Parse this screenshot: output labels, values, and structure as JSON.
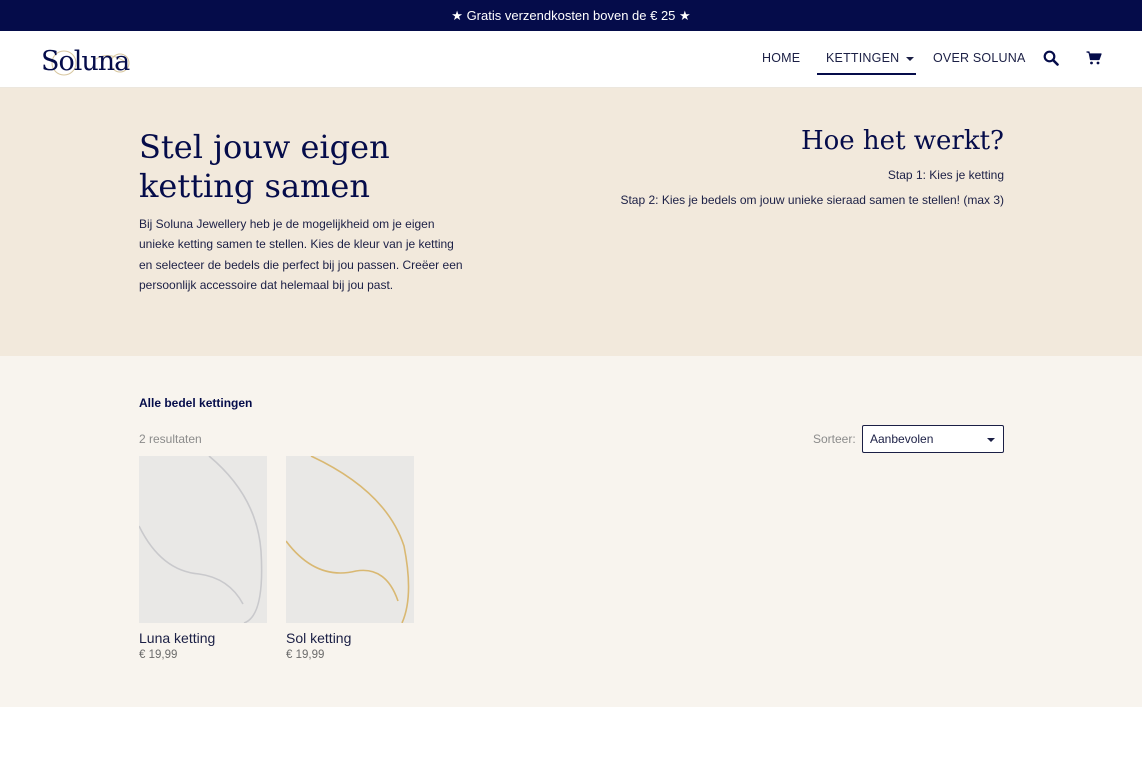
{
  "promo": {
    "text": "★ Gratis verzendkosten boven de € 25 ★"
  },
  "header": {
    "logo_text": "Soluna",
    "nav": {
      "home": "HOME",
      "kettingen": "KETTINGEN",
      "over": "OVER SOLUNA"
    },
    "icons": {
      "search": "search-icon",
      "cart": "cart-icon"
    }
  },
  "hero": {
    "title": "Stel jouw eigen ketting samen",
    "text": "Bij Soluna Jewellery heb je de mogelijkheid om je eigen unieke ketting samen te stellen. Kies de kleur van je ketting en selecteer de bedels die perfect bij jou passen. Creëer een persoonlijk accessoire dat helemaal bij jou past.",
    "how_title": "Hoe het werkt?",
    "step1": "Stap 1: Kies je ketting",
    "step2": "Stap 2: Kies je bedels om jouw unieke sieraad samen te stellen! (max 3)"
  },
  "catalog": {
    "title": "Alle bedel kettingen",
    "result_count": "2 resultaten",
    "sort_label": "Sorteer:",
    "sort_value": "Aanbevolen",
    "products": [
      {
        "name": "Luna ketting",
        "price": "€ 19,99",
        "chain_color": "#c9c9cc"
      },
      {
        "name": "Sol ketting",
        "price": "€ 19,99",
        "chain_color": "#d9b872"
      }
    ]
  },
  "colors": {
    "navy": "#050c4a",
    "hero_bg": "#f2e9dc",
    "catalog_bg": "#f8f4ee"
  }
}
